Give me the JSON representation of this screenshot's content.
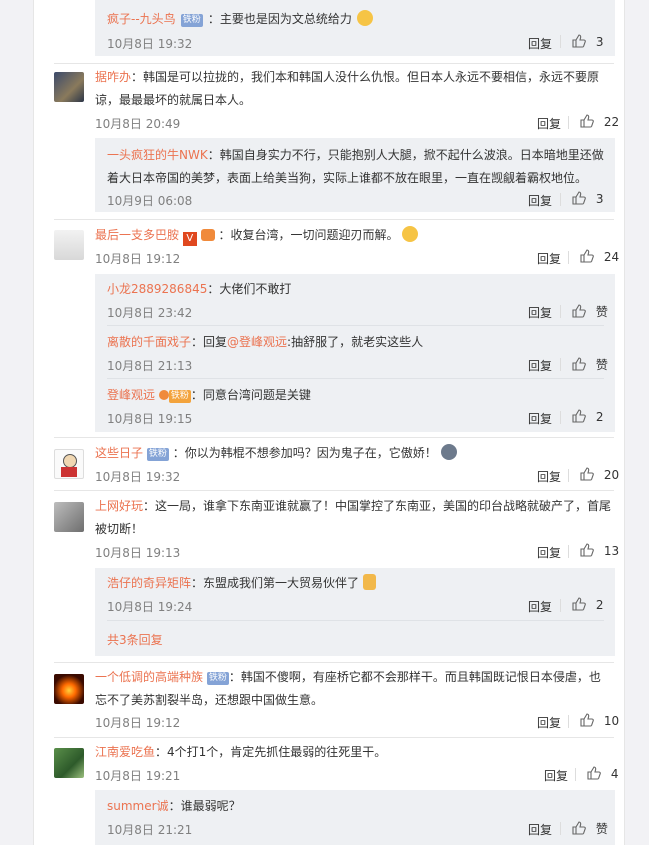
{
  "comments": [
    {
      "id": "c0",
      "replies": [
        {
          "user": "疯子--九头鸟",
          "badge": "铁粉",
          "text": "：主要也是因为文总统给力",
          "time": "10月8日 19:32",
          "reply": "回复",
          "likes": "3"
        }
      ]
    },
    {
      "id": "c1",
      "user": "据咋办",
      "text_l1": "：韩国是可以拉拢的，我们本和韩国人没什么仇恨。但日本人永远不要相信，永远不要原",
      "text_l2": "谅，最最最坏的就属日本人。",
      "time": "10月8日 20:49",
      "reply": "回复",
      "likes": "22",
      "replies": [
        {
          "user": "一头疯狂的牛NWK",
          "text_l1": "：韩国自身实力不行，只能抱别人大腿，掀不起什么波浪。日本暗地里还做",
          "text_l2": "着大日本帝国的美梦，表面上给美当狗，实际上谁都不放在眼里，一直在觊觎着霸权地位。",
          "time": "10月9日 06:08",
          "reply": "回复",
          "likes": "3"
        }
      ]
    },
    {
      "id": "c2",
      "user": "最后一支多巴胺",
      "text": "：收复台湾，一切问题迎刃而解。",
      "time": "10月8日 19:12",
      "reply": "回复",
      "likes": "24",
      "replies": [
        {
          "user": "小龙2889286845",
          "text": "：大佬们不敢打",
          "time": "10月8日 23:42",
          "reply": "回复",
          "likes": "赞"
        },
        {
          "user": "离散的千面戏子",
          "text_pre": "：回复",
          "mention": "@登峰观远",
          "text_post": ":抽舒服了，就老实这些人",
          "time": "10月8日 21:13",
          "reply": "回复",
          "likes": "赞"
        },
        {
          "user": "登峰观远",
          "badge": "铁粉",
          "text": "：同意台湾问题是关键",
          "time": "10月8日 19:15",
          "reply": "回复",
          "likes": "2"
        }
      ]
    },
    {
      "id": "c3",
      "user": "这些日子",
      "badge": "铁粉",
      "text": "：你以为韩棍不想参加吗？因为鬼子在，它傲娇！",
      "time": "10月8日 19:32",
      "reply": "回复",
      "likes": "20"
    },
    {
      "id": "c4",
      "user": "上网好玩",
      "text_l1": "：这一局，谁拿下东南亚谁就赢了！中国掌控了东南亚，美国的印台战略就破产了，首尾",
      "text_l2": "被切断！",
      "time": "10月8日 19:13",
      "reply": "回复",
      "likes": "13",
      "replies": [
        {
          "user": "浩仔的奇异矩阵",
          "text": "：东盟成我们第一大贸易伙伴了",
          "time": "10月8日 19:24",
          "reply": "回复",
          "likes": "2"
        }
      ],
      "more": "共3条回复"
    },
    {
      "id": "c5",
      "user": "一个低调的高端种族",
      "badge": "铁粉",
      "text_l1": "：韩国不傻啊，有座桥它都不会那样干。而且韩国既记恨日本侵虐，也",
      "text_l2": "忘不了美苏割裂半岛，还想跟中国做生意。",
      "time": "10月8日 19:12",
      "reply": "回复",
      "likes": "10"
    },
    {
      "id": "c6",
      "user": "江南爱吃鱼",
      "text": "：4个打1个，肯定先抓住最弱的往死里干。",
      "time": "10月8日 19:21",
      "reply": "回复",
      "likes": "4",
      "replies": [
        {
          "user": "summer诚",
          "text": "：谁最弱呢？",
          "time": "10月8日 21:21",
          "reply": "回复",
          "likes": "赞"
        }
      ]
    }
  ],
  "colors": {
    "username": "#eb7350",
    "text": "#333333",
    "time": "#808080",
    "subbg": "#eef0f3"
  }
}
